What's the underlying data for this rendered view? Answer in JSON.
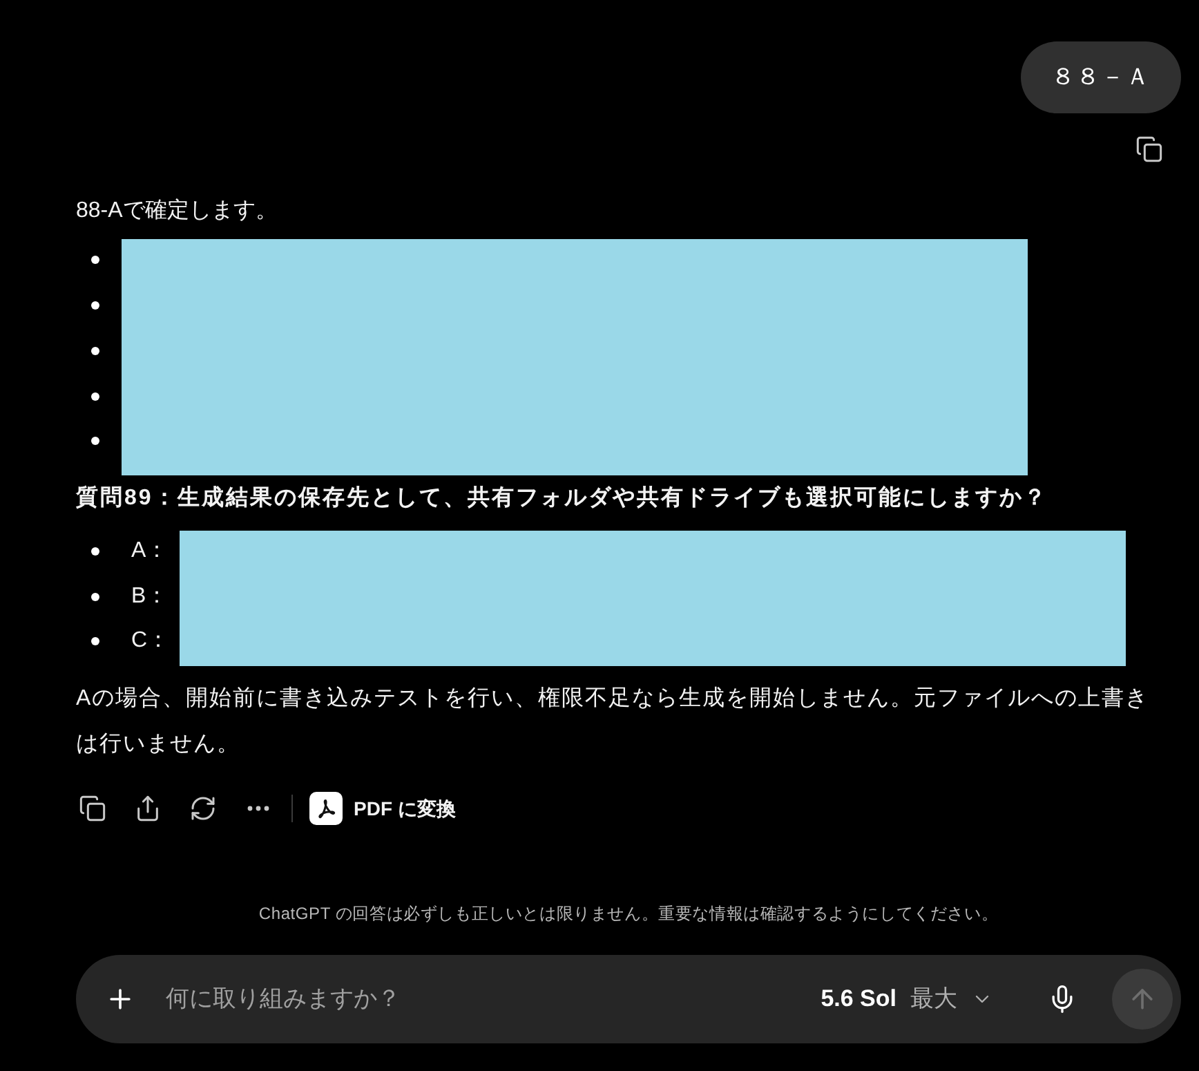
{
  "user_message": {
    "text": "８８－Ａ"
  },
  "assistant_message": {
    "intro": "88-Aで確定します。",
    "confirm_list": {
      "redacted": true,
      "items": [
        {
          "kind": "hidden"
        },
        {
          "kind": "hidden"
        },
        {
          "kind": "hidden"
        },
        {
          "kind": "hidden"
        },
        {
          "kind": "hidden"
        }
      ]
    },
    "question": "質問89：生成結果の保存先として、共有フォルダや共有ドライブも選択可能にしますか？",
    "options": {
      "redacted": true,
      "items": [
        {
          "label": "A："
        },
        {
          "label": "B："
        },
        {
          "label": "C："
        }
      ]
    },
    "note": "Aの場合、開始前に書き込みテストを行い、権限不足なら生成を開始しません。元ファイルへの上書きは行いません。",
    "actions": {
      "convert_button": "PDF に変換"
    }
  },
  "disclaimer": "ChatGPT の回答は必ずしも正しいとは限りません。重要な情報は確認するようにしてください。",
  "composer": {
    "placeholder": "何に取り組みますか？",
    "model": "5.6 Sol",
    "mode": "最大"
  }
}
